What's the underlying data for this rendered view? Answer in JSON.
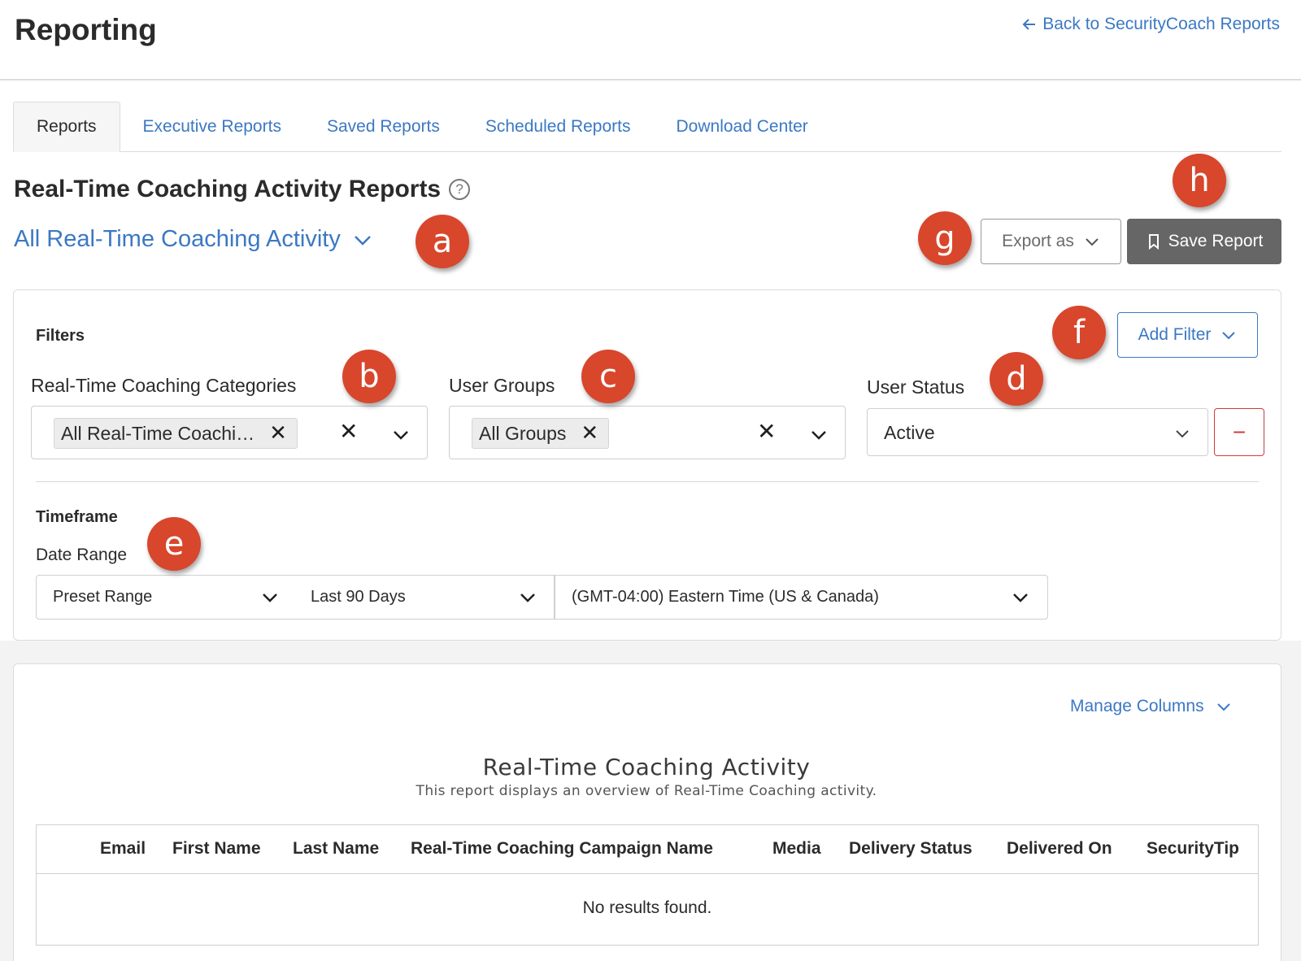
{
  "header": {
    "title": "Reporting",
    "back_link": "Back to SecurityCoach Reports"
  },
  "tabs": [
    {
      "label": "Reports",
      "active": true
    },
    {
      "label": "Executive Reports",
      "active": false
    },
    {
      "label": "Saved Reports",
      "active": false
    },
    {
      "label": "Scheduled Reports",
      "active": false
    },
    {
      "label": "Download Center",
      "active": false
    }
  ],
  "section": {
    "title": "Real-Time Coaching Activity Reports",
    "help_icon": "question-circle-icon",
    "report_selector": "All Real-Time Coaching Activity"
  },
  "toolbar": {
    "export_label": "Export as",
    "save_label": "Save Report"
  },
  "filters": {
    "heading": "Filters",
    "add_filter_label": "Add Filter",
    "categories": {
      "label": "Real-Time Coaching Categories",
      "chip": "All Real-Time Coachi…"
    },
    "user_groups": {
      "label": "User Groups",
      "chip": "All Groups"
    },
    "user_status": {
      "label": "User Status",
      "value": "Active"
    },
    "remove_symbol": "−"
  },
  "timeframe": {
    "heading": "Timeframe",
    "date_range_label": "Date Range",
    "preset": "Preset Range",
    "range": "Last 90 Days",
    "timezone": "(GMT-04:00) Eastern Time (US & Canada)"
  },
  "results": {
    "manage_columns": "Manage Columns",
    "title": "Real-Time Coaching Activity",
    "subtitle": "This report displays an overview of Real-Time Coaching activity.",
    "columns": [
      "Email",
      "First Name",
      "Last Name",
      "Real-Time Coaching Campaign Name",
      "Media",
      "Delivery Status",
      "Delivered On",
      "SecurityTip"
    ],
    "empty_message": "No results found."
  },
  "annotations": {
    "a": "a",
    "b": "b",
    "c": "c",
    "d": "d",
    "e": "e",
    "f": "f",
    "g": "g",
    "h": "h",
    "color": "#d8462c"
  },
  "colors": {
    "link": "#3b78c4",
    "save_button": "#666666",
    "remove_button": "#d33a3a"
  }
}
